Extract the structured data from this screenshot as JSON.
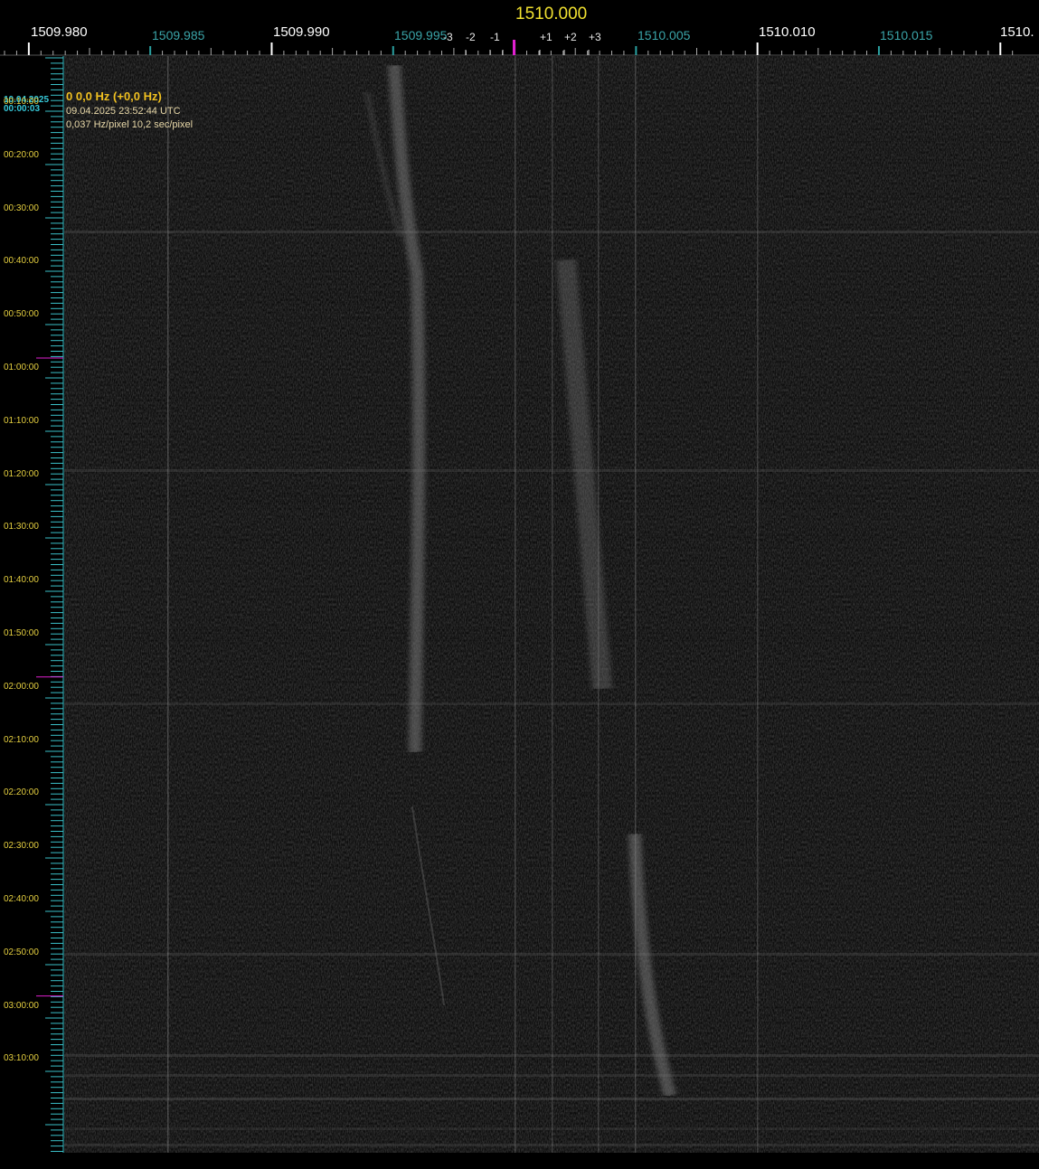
{
  "header": {
    "center_frequency": "1510.000",
    "major_labels": [
      "1509.980",
      "1509.990",
      "1510.010",
      "1510."
    ],
    "minor_labels": [
      "1509.985",
      "1509.995",
      "1510.005",
      "1510.015"
    ],
    "offset_labels": [
      "-3",
      "-2",
      "-1",
      "+1",
      "+2",
      "+3"
    ]
  },
  "overlay": {
    "date": "10.04.2025",
    "time": "00:00:03",
    "offset": "0 0,0 Hz (+0,0 Hz)",
    "utc": "09.04.2025 23:52:44 UTC",
    "resolution": "0,037 Hz/pixel 10,2 sec/pixel"
  },
  "time_scale": {
    "labels": [
      "00:10:00",
      "00:20:00",
      "00:30:00",
      "00:40:00",
      "00:50:00",
      "01:00:00",
      "01:10:00",
      "01:20:00",
      "01:30:00",
      "01:40:00",
      "01:50:00",
      "02:00:00",
      "02:10:00",
      "02:20:00",
      "02:30:00",
      "02:40:00",
      "02:50:00",
      "03:00:00",
      "03:10:00"
    ]
  },
  "colors": {
    "background": "#000000",
    "center_marker": "#e020d0",
    "title": "#f0e030",
    "major_tick": "#ffffff",
    "minor_tick": "#2aa0a0",
    "time_label": "#e6d040",
    "date_stamp": "#36c8d8"
  }
}
